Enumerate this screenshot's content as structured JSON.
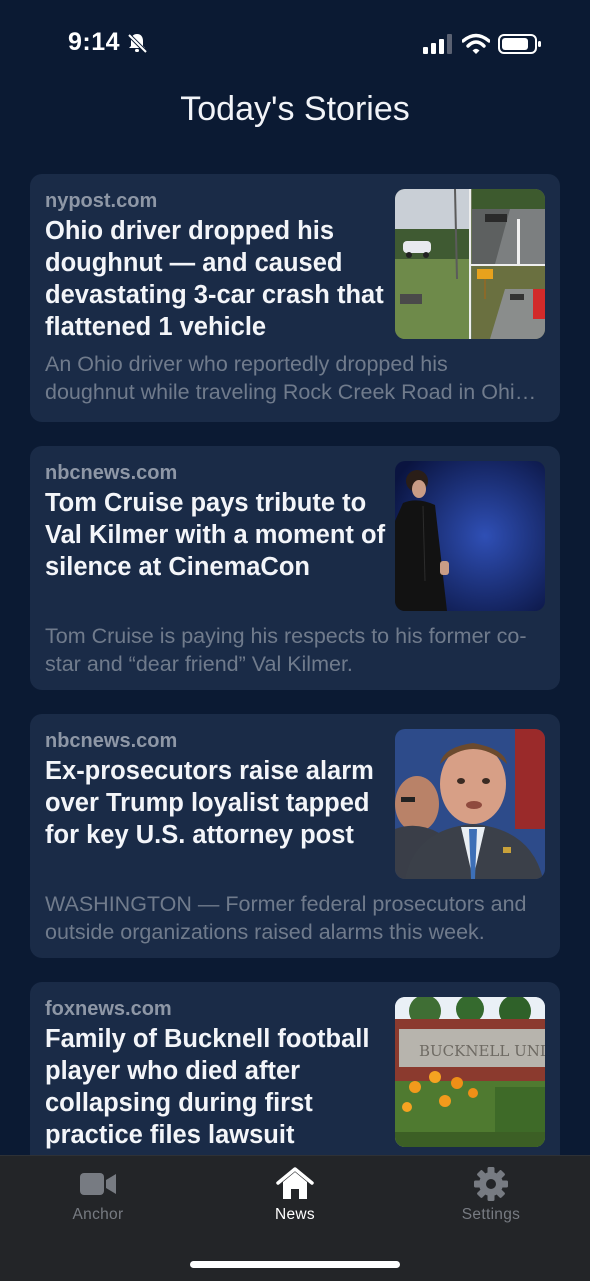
{
  "status_bar": {
    "time": "9:14"
  },
  "page": {
    "title": "Today's Stories"
  },
  "stories": [
    {
      "source": "nypost.com",
      "headline": "Ohio driver dropped his doughnut — and caused devastating 3-car crash that flattened 1 vehicle",
      "summary": "An Ohio driver who reportedly dropped his doughnut while traveling Rock Creek Road in Ohio caused a devastating crash."
    },
    {
      "source": "nbcnews.com",
      "headline": "Tom Cruise pays tribute to Val Kilmer with a moment of silence at CinemaCon",
      "summary": "Tom Cruise is paying his respects to his former co-star and “dear friend” Val Kilmer."
    },
    {
      "source": "nbcnews.com",
      "headline": "Ex-prosecutors raise alarm over Trump loyalist tapped for key U.S. attorney post",
      "summary": "WASHINGTON — Former federal prosecutors and outside organizations raised alarms this week."
    },
    {
      "source": "foxnews.com",
      "headline": "Family of Bucknell football player who died after collapsing during first practice files lawsuit",
      "summary": ""
    }
  ],
  "thumbnails": {
    "sign_text": "BUCKNELL UNIVE"
  },
  "tab_bar": {
    "tabs": [
      {
        "label": "Anchor",
        "icon": "video-camera-icon",
        "active": false
      },
      {
        "label": "News",
        "icon": "home-icon",
        "active": true
      },
      {
        "label": "Settings",
        "icon": "gear-icon",
        "active": false
      }
    ]
  }
}
